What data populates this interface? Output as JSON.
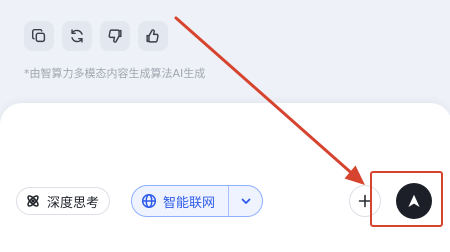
{
  "actions": {
    "copy_icon": "copy-icon",
    "regenerate_icon": "refresh-icon",
    "dislike_icon": "thumbs-down-icon",
    "like_icon": "thumbs-up-icon"
  },
  "disclaimer": "*由智算力多模态内容生成算法AI生成",
  "input_bar": {
    "deep_think_label": "深度思考",
    "web_search_label": "智能联网"
  },
  "annotation": {
    "color": "#d6442f"
  },
  "colors": {
    "accent_blue": "#2f5bea",
    "send_button": "#1c1f27",
    "page_background": "#eef1f7"
  }
}
